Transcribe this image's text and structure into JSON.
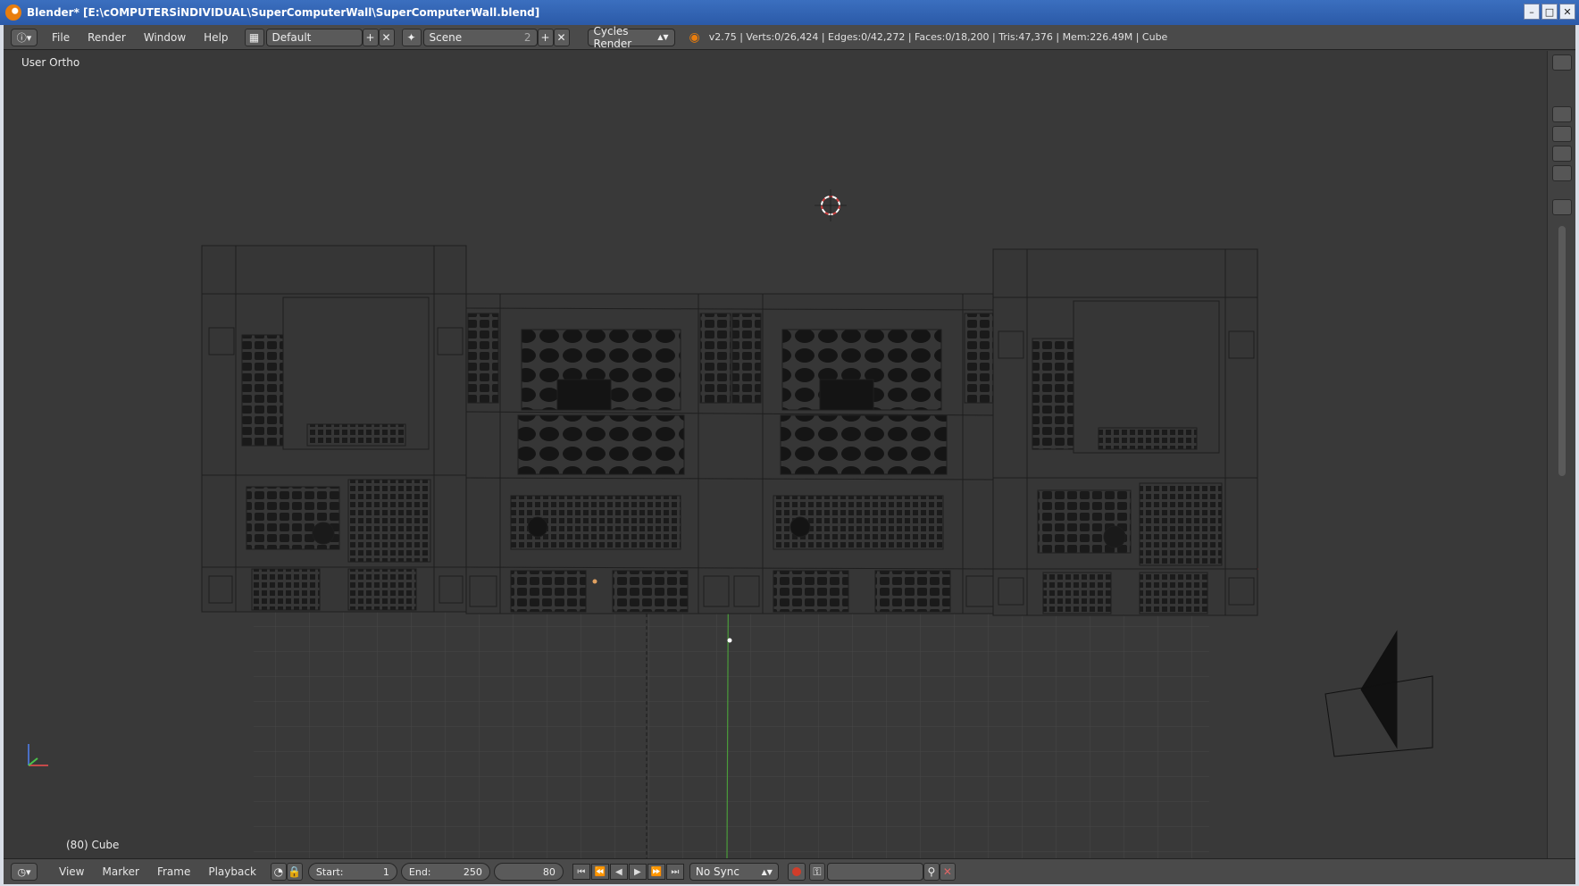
{
  "window": {
    "title": "Blender* [E:\\cOMPUTERSiNDIVIDUAL\\SuperComputerWall\\SuperComputerWall.blend]",
    "buttons": [
      "minimize-icon",
      "maximize-icon",
      "close-icon"
    ]
  },
  "info_header": {
    "menus": [
      "File",
      "Render",
      "Window",
      "Help"
    ],
    "screen_layout": "Default",
    "scene": "Scene",
    "scene_users": "2",
    "render_engine": "Cycles Render",
    "stats": "v2.75 | Verts:0/26,424 | Edges:0/42,272 | Faces:0/18,200 | Tris:47,376 | Mem:226.49M | Cube"
  },
  "viewport": {
    "view_label": "User Ortho",
    "object_label": "(80) Cube"
  },
  "timeline": {
    "menus": [
      "View",
      "Marker",
      "Frame",
      "Playback"
    ],
    "start_label": "Start:",
    "start_value": "1",
    "end_label": "End:",
    "end_value": "250",
    "current_frame": "80",
    "sync_mode": "No Sync"
  },
  "colors": {
    "viewport_bg": "#393939",
    "grid": "#4a4a4a",
    "wire": "#111111",
    "x_axis": "#9c3030",
    "y_axis": "#4a9c3a",
    "title_bar": "#2b5aa8"
  }
}
